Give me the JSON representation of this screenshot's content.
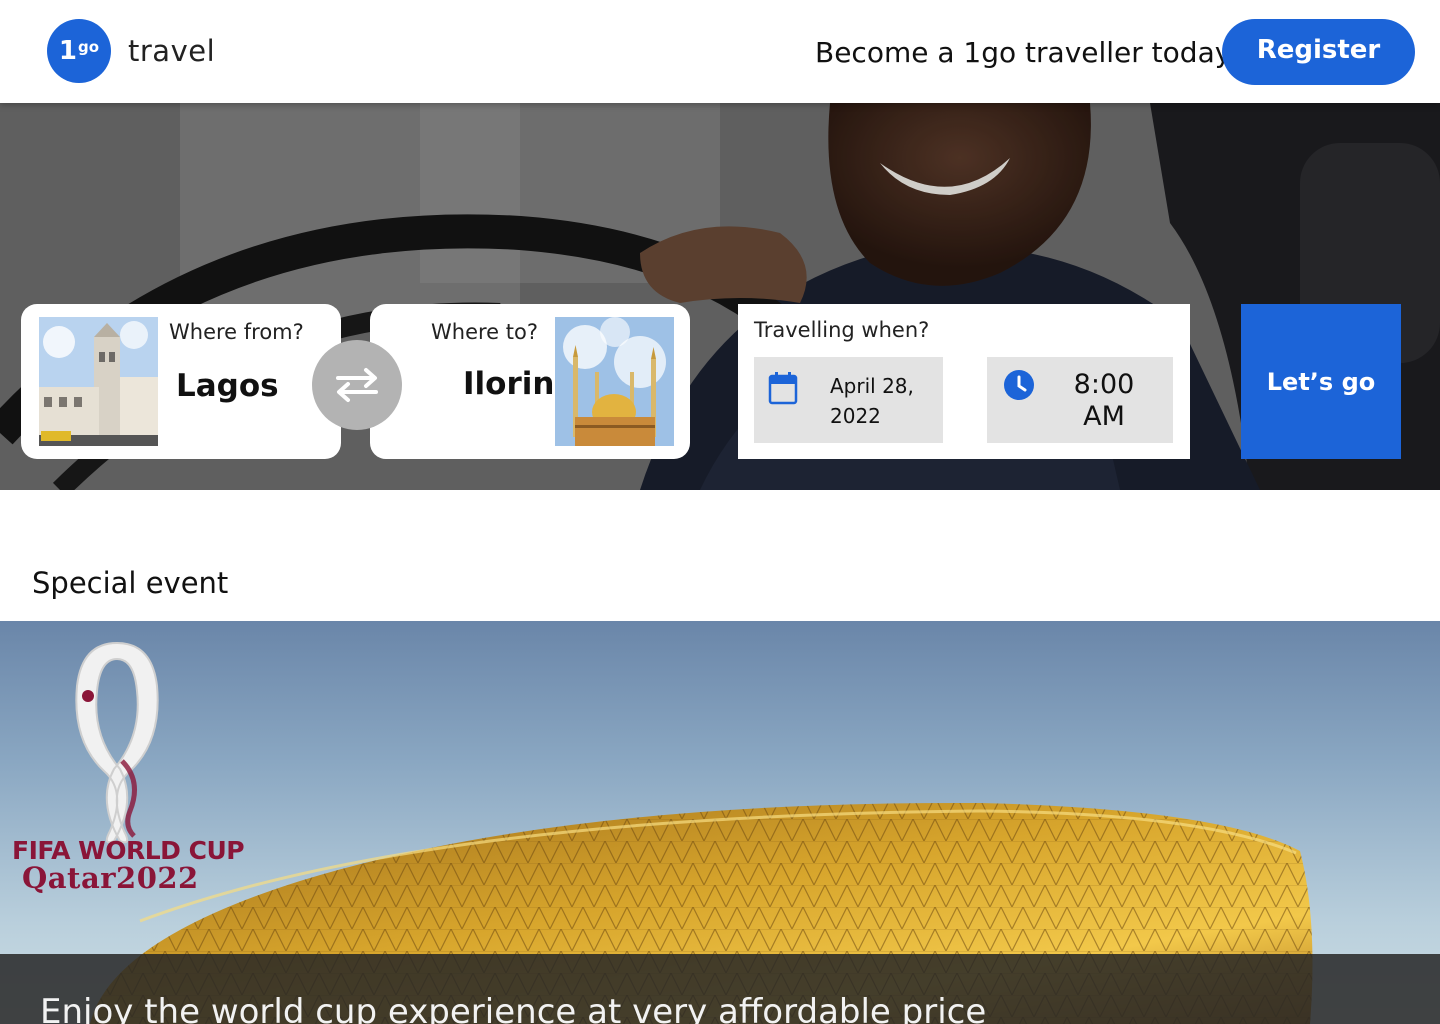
{
  "header": {
    "logo_one": "1",
    "logo_go": "go",
    "brand_name": "travel",
    "tagline": "Become a 1go traveller today",
    "register_label": "Register"
  },
  "search": {
    "from_label": "Where from?",
    "from_city": "Lagos",
    "to_label": "Where to?",
    "to_city": "Ilorin",
    "when_label": "Travelling when?",
    "date_line1": "April 28,",
    "date_line2": "2022",
    "time_line1": "8:00",
    "time_line2": "AM",
    "go_label": "Let’s go"
  },
  "special_event": {
    "title": "Special event",
    "logo_line1": "FIFA WORLD CUP",
    "logo_line2": "Qatar2022",
    "caption": "Enjoy the world cup experience at very affordable price"
  },
  "colors": {
    "accent": "#1c64d8",
    "swap_button": "#b3b3b3",
    "field_bg": "#e3e3e3",
    "fifa_maroon": "#8a1538"
  },
  "icons": [
    "swap-arrows-icon",
    "calendar-icon",
    "clock-icon"
  ]
}
